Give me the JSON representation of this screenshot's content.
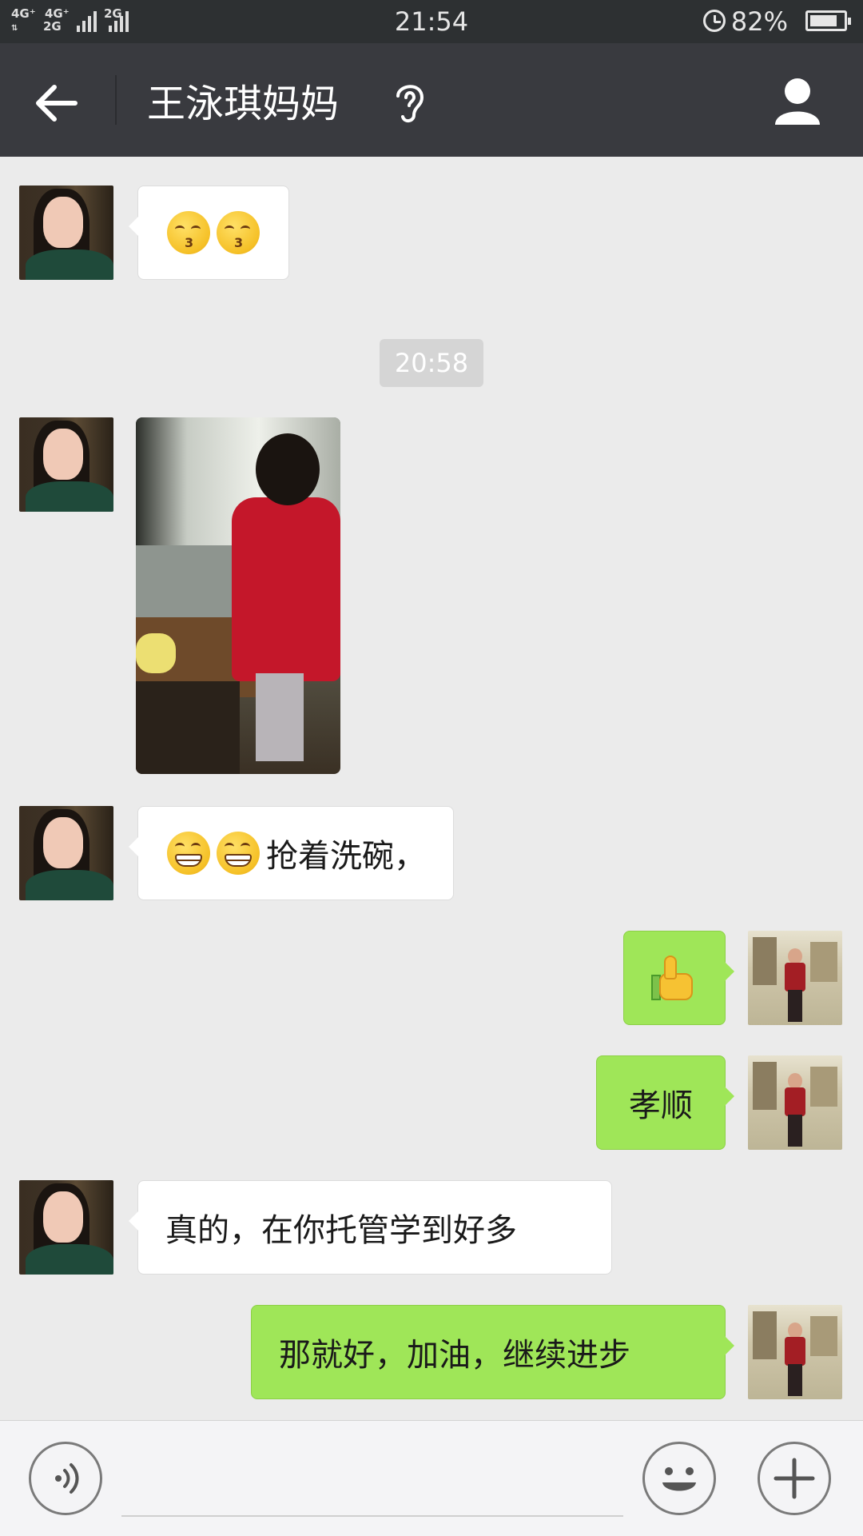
{
  "status_bar": {
    "network_1": "4G⁺",
    "network_1b": "2G",
    "network_2": "4G⁺",
    "network_3": "2G",
    "time": "21:54",
    "battery_percent": "82%",
    "battery_level": 0.82
  },
  "header": {
    "title": "王泳琪妈妈"
  },
  "messages": [
    {
      "side": "received",
      "type": "emoji",
      "emojis": [
        "kissing-closed-eyes",
        "kissing-closed-eyes"
      ]
    },
    {
      "type": "timestamp",
      "text": "20:58"
    },
    {
      "side": "received",
      "type": "image",
      "subject": "girl washing dishes"
    },
    {
      "side": "received",
      "type": "text",
      "emojis": [
        "grinning",
        "grinning"
      ],
      "text": "抢着洗碗，"
    },
    {
      "side": "sent",
      "type": "emoji",
      "emojis": [
        "thumbs-up"
      ]
    },
    {
      "side": "sent",
      "type": "text",
      "text": "孝顺"
    },
    {
      "side": "received",
      "type": "text",
      "text": "真的，在你托管学到好多"
    },
    {
      "side": "sent",
      "type": "text",
      "text": "那就好，加油，继续进步"
    }
  ],
  "colors": {
    "titlebar": "#393a3f",
    "sent_bubble": "#9fe658",
    "received_bubble": "#ffffff",
    "chat_bg": "#ebebeb"
  }
}
